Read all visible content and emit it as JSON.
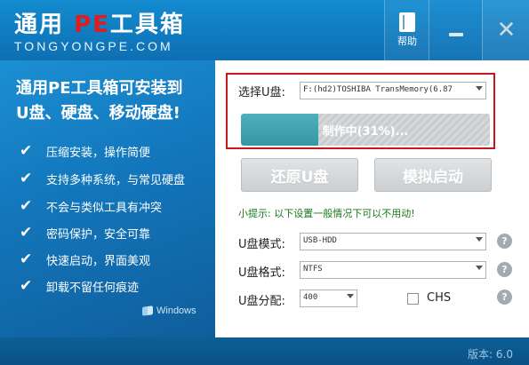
{
  "titlebar": {
    "brand_prefix": "通用 ",
    "brand_pe": "PE",
    "brand_suffix": "工具箱",
    "brand_sub": "TONGYONGPE.COM",
    "help_label": "帮助",
    "help_icon": "book-icon",
    "minimize_icon": "minimize-icon",
    "close_icon": "close-icon"
  },
  "left": {
    "headline_line1": "通用PE工具箱可安装到",
    "headline_line2": "U盘、硬盘、移动硬盘!",
    "features": [
      "压缩安装，操作简便",
      "支持多种系统，与常见硬盘",
      "不会与类似工具有冲突",
      "密码保护，安全可靠",
      "快速启动，界面美观",
      "卸载不留任何痕迹"
    ],
    "windows_logo_text": "Windows"
  },
  "right": {
    "select_u_label": "选择U盘:",
    "select_u_value": "F:(hd2)TOSHIBA TransMemory(6.87",
    "progress_text": "制作中(31%)...",
    "progress_fraction": 0.31,
    "restore_button": "还原U盘",
    "simulate_button": "模拟启动",
    "tip_text": "小提示: 以下设置一般情况下可以不用动!",
    "mode_label": "U盘模式:",
    "mode_value": "USB-HDD",
    "format_label": "U盘格式:",
    "format_value": "NTFS",
    "alloc_label": "U盘分配:",
    "alloc_value": "400",
    "chs_label": "CHS"
  },
  "status": {
    "version": "版本: 6.0"
  }
}
